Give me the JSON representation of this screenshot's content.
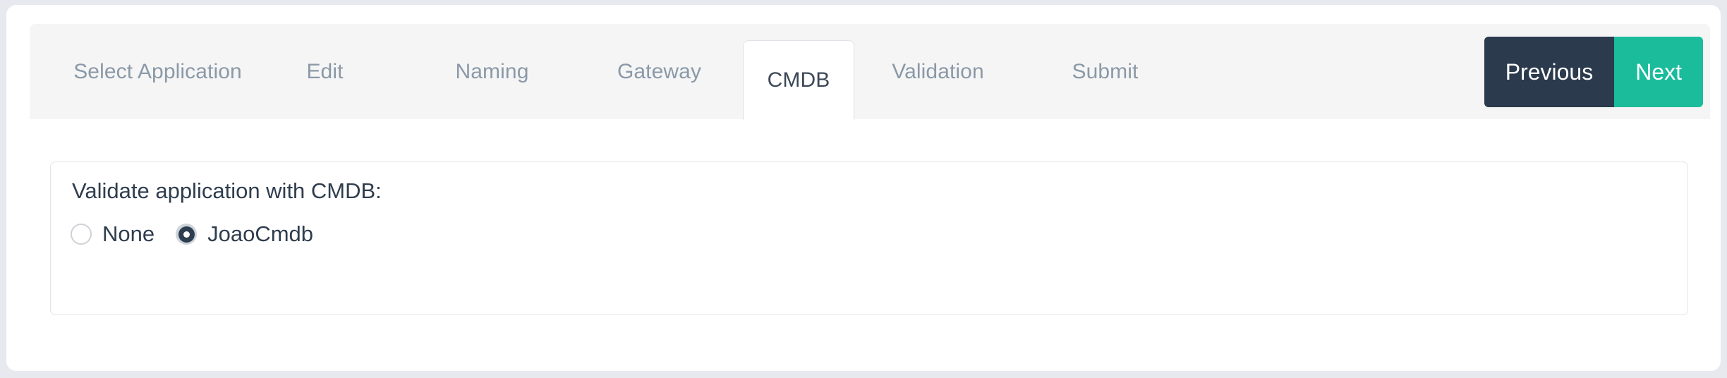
{
  "wizard": {
    "tabs": [
      {
        "id": "select-application",
        "label": "Select Application",
        "active": false
      },
      {
        "id": "edit",
        "label": "Edit",
        "active": false
      },
      {
        "id": "naming",
        "label": "Naming",
        "active": false
      },
      {
        "id": "gateway",
        "label": "Gateway",
        "active": false
      },
      {
        "id": "cmdb",
        "label": "CMDB",
        "active": true
      },
      {
        "id": "validation",
        "label": "Validation",
        "active": false
      },
      {
        "id": "submit",
        "label": "Submit",
        "active": false
      }
    ],
    "nav": {
      "previous_label": "Previous",
      "next_label": "Next",
      "previous_color": "#2b3a4d",
      "next_color": "#1abc9c"
    }
  },
  "panel": {
    "label": "Validate application with CMDB:",
    "radio_group_name": "cmdb-validation",
    "options": [
      {
        "id": "none",
        "label": "None",
        "selected": false
      },
      {
        "id": "joaocmdb",
        "label": "JoaoCmdb",
        "selected": true
      }
    ],
    "selected_value": "JoaoCmdb"
  },
  "theme": {
    "page_background": "#e8e9ef",
    "card_background": "#ffffff",
    "tabstrip_background": "#f5f5f6",
    "tab_inactive_text": "#8b99a7",
    "tab_active_text": "#3c4858",
    "body_text": "#2f3d4e",
    "border": "#e2e4e7",
    "radio_selected": "#2d3e50",
    "radio_halo": "#ced4da"
  }
}
